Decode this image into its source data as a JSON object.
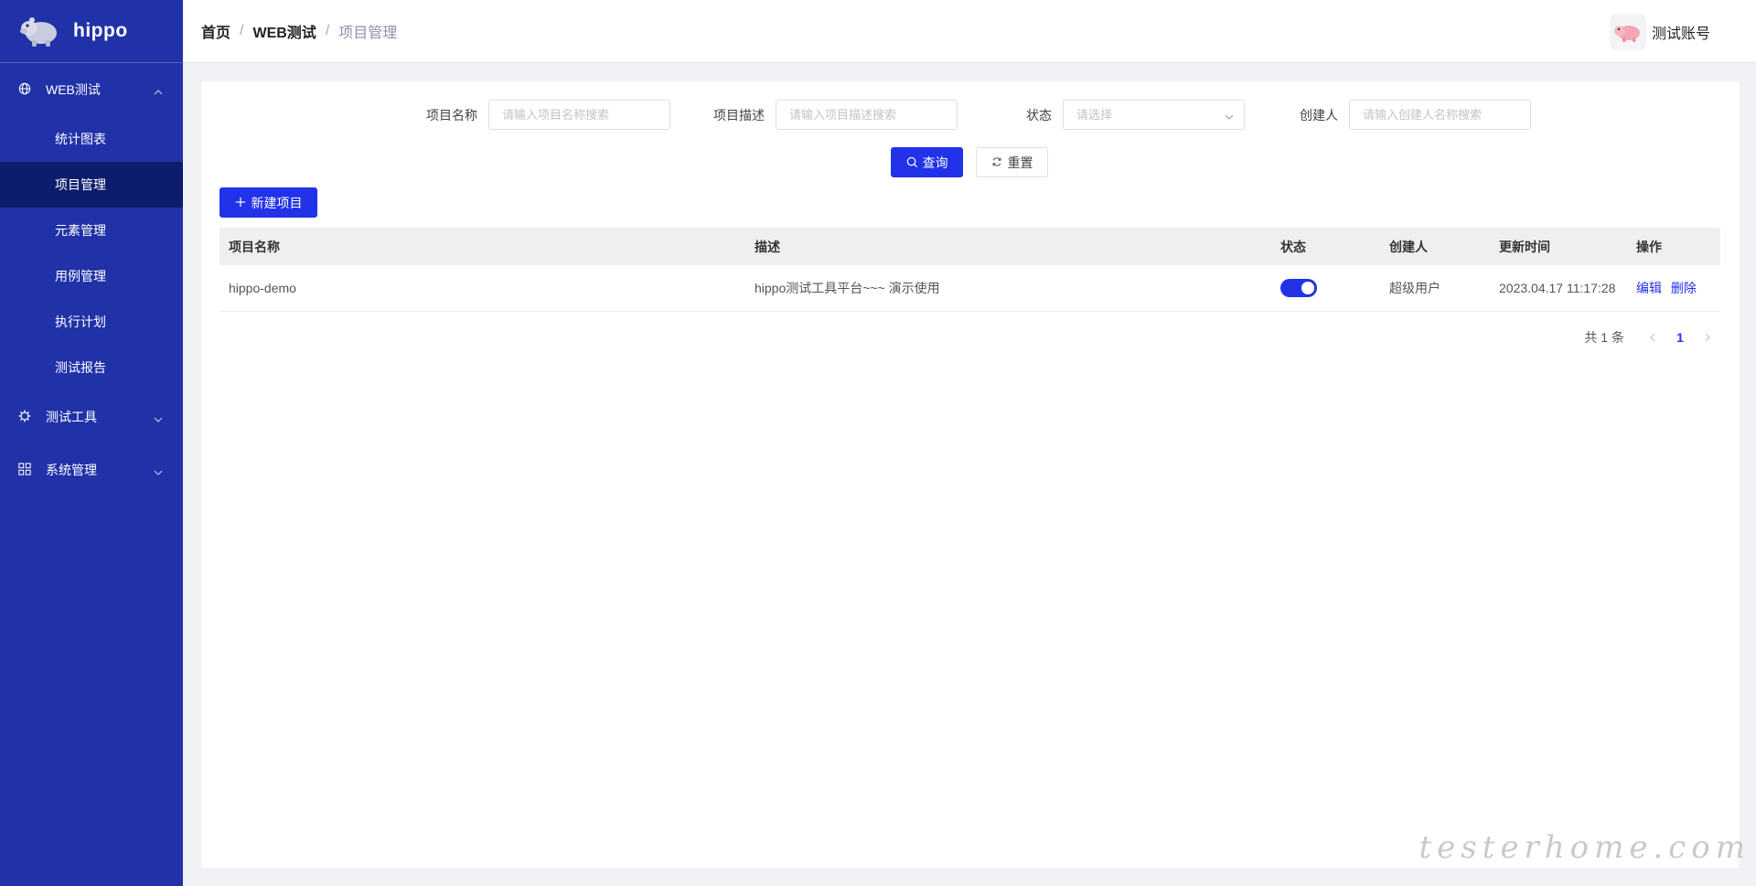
{
  "app": {
    "name": "hippo"
  },
  "sidebar": {
    "groups": [
      {
        "label": "WEB测试",
        "icon": "globe-icon",
        "expanded": true,
        "items": [
          {
            "label": "统计图表"
          },
          {
            "label": "项目管理",
            "active": true
          },
          {
            "label": "元素管理"
          },
          {
            "label": "用例管理"
          },
          {
            "label": "执行计划"
          },
          {
            "label": "测试报告"
          }
        ]
      },
      {
        "label": "测试工具",
        "icon": "gear-icon",
        "expanded": false
      },
      {
        "label": "系统管理",
        "icon": "grid-icon",
        "expanded": false
      }
    ]
  },
  "header": {
    "breadcrumb": [
      "首页",
      "WEB测试",
      "项目管理"
    ],
    "separator": "/",
    "user_name": "测试账号"
  },
  "filters": {
    "project_name": {
      "label": "项目名称",
      "placeholder": "请输入项目名称搜索"
    },
    "project_desc": {
      "label": "项目描述",
      "placeholder": "请输入项目描述搜索"
    },
    "status": {
      "label": "状态",
      "placeholder": "请选择"
    },
    "creator": {
      "label": "创建人",
      "placeholder": "请输入创建人名称搜索"
    }
  },
  "buttons": {
    "search": "查询",
    "reset": "重置",
    "new_project": "新建项目"
  },
  "table": {
    "headers": [
      "项目名称",
      "描述",
      "状态",
      "创建人",
      "更新时间",
      "操作"
    ],
    "rows": [
      {
        "name": "hippo-demo",
        "desc": "hippo测试工具平台~~~ 演示使用",
        "status_on": true,
        "creator": "超级用户",
        "updated": "2023.04.17 11:17:28",
        "edit": "编辑",
        "delete": "删除"
      }
    ]
  },
  "pagination": {
    "total": "共 1 条",
    "current": "1"
  },
  "watermark": "testerhome.com",
  "colors": {
    "sidebar": "#2132a8",
    "sidebar_active": "#0d1d6b",
    "primary": "#2132e8"
  }
}
